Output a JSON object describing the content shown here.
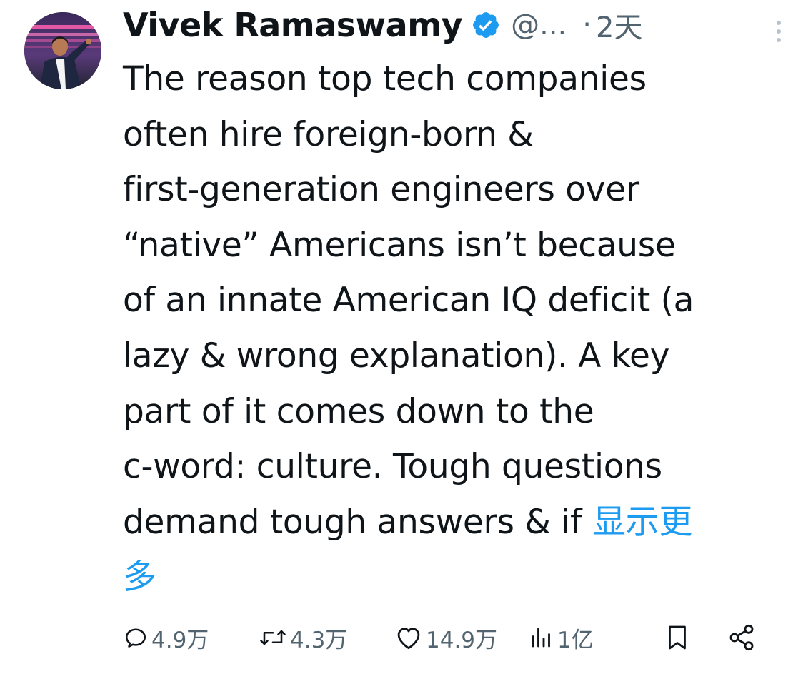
{
  "author": {
    "display_name": "Vivek Ramaswamy",
    "handle": "@...",
    "separator": "·",
    "time": "2天",
    "verified": true
  },
  "tweet": {
    "text": "The reason top tech companies\noften hire foreign-born &\nfirst-generation engineers over\n“native” Americans isn’t because\nof an innate American IQ deficit (a\nlazy & wrong explanation). A key\npart of it comes down to the\nc-word: culture. Tough questions\ndemand tough answers & if ",
    "show_more_line1": "显示更",
    "show_more_line2": "多"
  },
  "actions": {
    "replies": "4.9万",
    "retweets": "4.3万",
    "likes": "14.9万",
    "views": "1亿"
  },
  "colors": {
    "accent": "#1d9bf0",
    "text": "#0f1419",
    "muted": "#536471"
  },
  "icons": {
    "reply": "reply-icon",
    "retweet": "retweet-icon",
    "like": "heart-icon",
    "views": "views-icon",
    "bookmark": "bookmark-icon",
    "share": "share-icon",
    "verified": "verified-badge-icon",
    "more": "more-options-icon"
  }
}
